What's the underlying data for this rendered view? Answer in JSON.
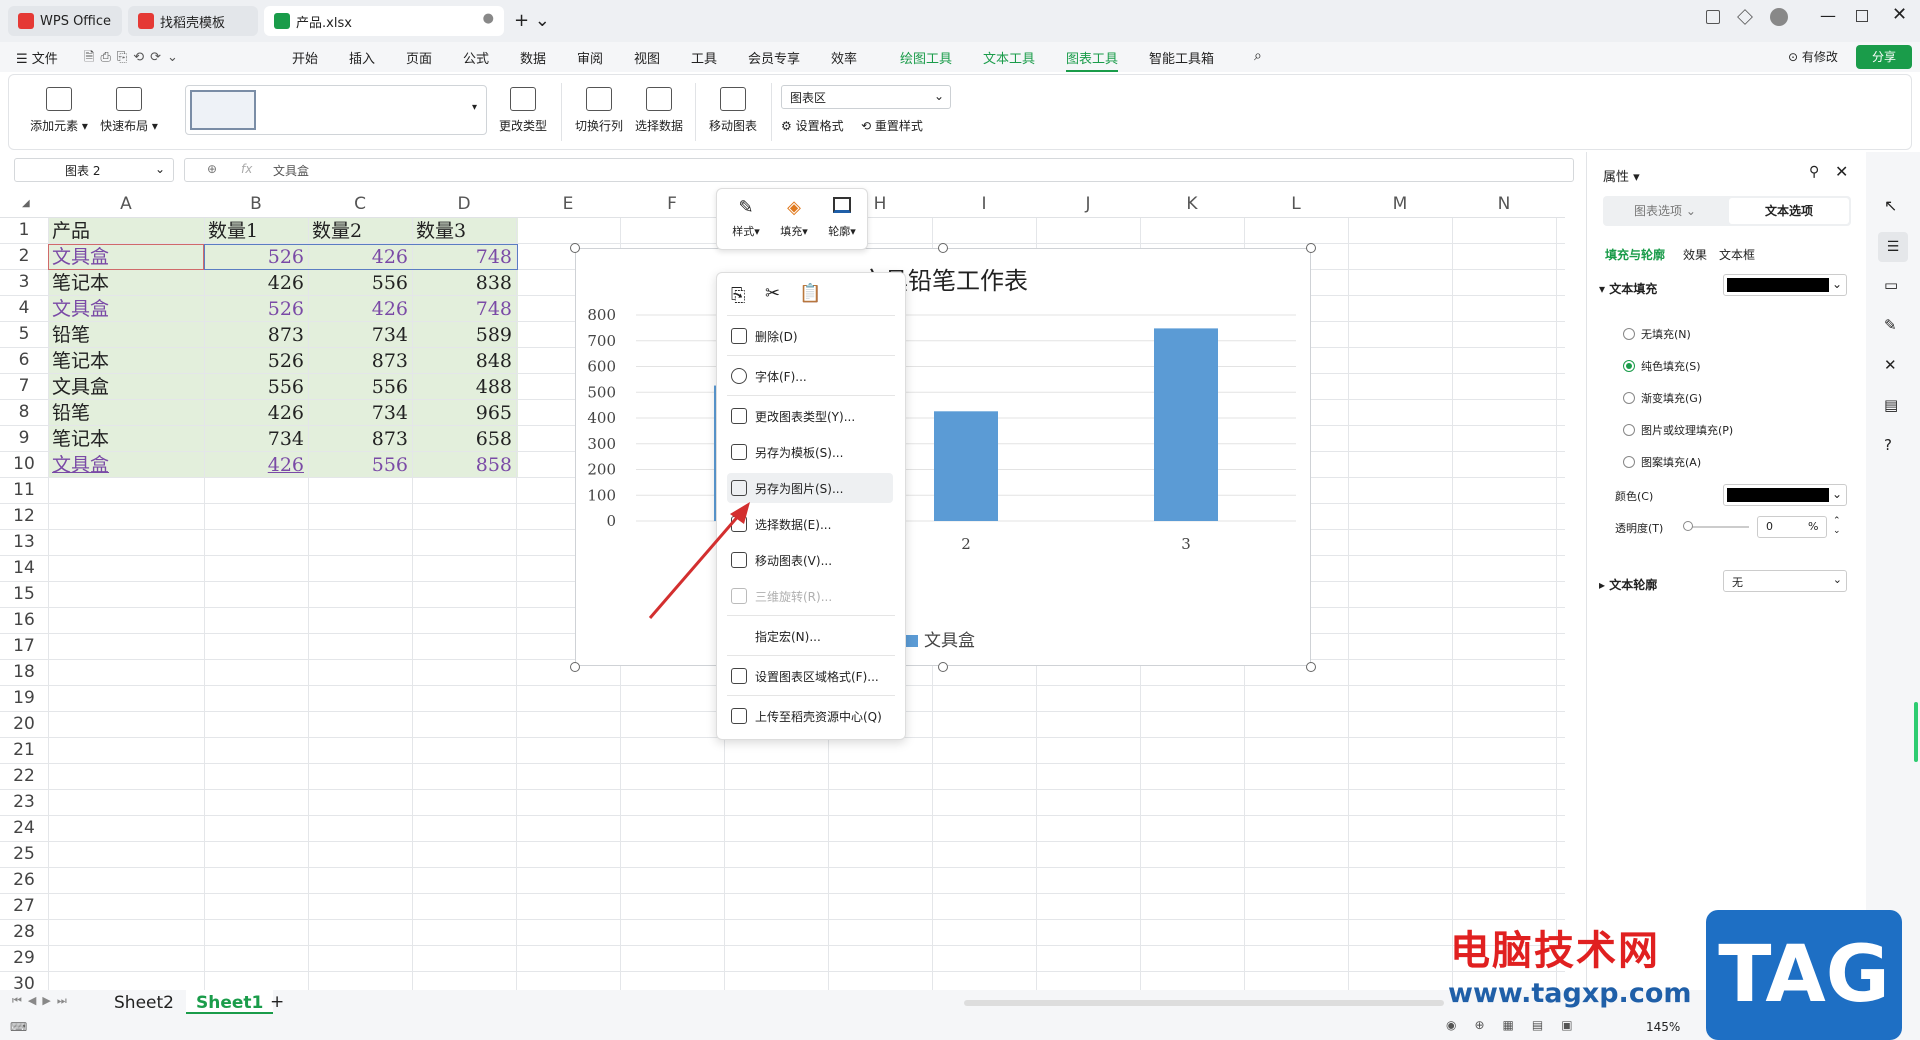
{
  "tabs": [
    {
      "label": "WPS Office"
    },
    {
      "label": "找稻壳模板"
    },
    {
      "label": "产品.xlsx"
    }
  ],
  "titlebar_right": {
    "revision": "有修改",
    "share": "分享"
  },
  "menu": [
    "文件",
    "开始",
    "插入",
    "页面",
    "公式",
    "数据",
    "审阅",
    "视图",
    "工具",
    "会员专享",
    "效率",
    "绘图工具",
    "文本工具",
    "图表工具",
    "智能工具箱"
  ],
  "ribbon": {
    "add_element": "添加元素",
    "quick_layout": "快速布局",
    "change_type": "更改类型",
    "switch_rowcol": "切换行列",
    "select_data": "选择数据",
    "move_chart": "移动图表",
    "chart_area": "图表区",
    "set_format": "设置格式",
    "reset_style": "重置样式"
  },
  "formula": {
    "name_box": "图表 2",
    "fx": "fx",
    "value": "文具盒"
  },
  "columns": [
    "A",
    "B",
    "C",
    "D",
    "E",
    "F",
    "G",
    "H",
    "I",
    "J",
    "K",
    "L",
    "M",
    "N"
  ],
  "sheet": {
    "header": [
      "产品",
      "数量1",
      "数量2",
      "数量3"
    ],
    "rows": [
      [
        "文具盒",
        "526",
        "426",
        "748"
      ],
      [
        "笔记本",
        "426",
        "556",
        "838"
      ],
      [
        "文具盒",
        "526",
        "426",
        "748"
      ],
      [
        "铅笔",
        "873",
        "734",
        "589"
      ],
      [
        "笔记本",
        "526",
        "873",
        "848"
      ],
      [
        "文具盒",
        "556",
        "556",
        "488"
      ],
      [
        "铅笔",
        "426",
        "734",
        "965"
      ],
      [
        "笔记本",
        "734",
        "873",
        "658"
      ],
      [
        "文具盒",
        "426",
        "556",
        "858"
      ]
    ],
    "row_numbers": [
      "1",
      "2",
      "3",
      "4",
      "5",
      "6",
      "7",
      "8",
      "9",
      "10",
      "11",
      "12",
      "13",
      "14",
      "15",
      "16",
      "17",
      "18",
      "19",
      "20",
      "21",
      "22",
      "23",
      "24",
      "25",
      "26",
      "27",
      "28",
      "29",
      "30"
    ]
  },
  "chart_toolbar": {
    "style": "样式",
    "fill": "填充",
    "outline": "轮廓"
  },
  "chart_data": {
    "type": "bar",
    "title": "文具铅笔工作表",
    "categories": [
      "1",
      "2",
      "3"
    ],
    "series": [
      {
        "name": "文具盒",
        "values": [
          526,
          426,
          748
        ]
      }
    ],
    "ylim": [
      0,
      800
    ],
    "yticks": [
      "800",
      "700",
      "600",
      "500",
      "400",
      "300",
      "200",
      "100",
      "0"
    ],
    "legend": "bottom",
    "color": "#5b9bd5"
  },
  "context_menu": {
    "items": [
      "删除(D)",
      "字体(F)...",
      "更改图表类型(Y)...",
      "另存为模板(S)...",
      "另存为图片(S)...",
      "选择数据(E)...",
      "移动图表(V)...",
      "三维旋转(R)...",
      "指定宏(N)...",
      "设置图表区域格式(F)...",
      "上传至稻壳资源中心(Q)"
    ]
  },
  "panel": {
    "title": "属性",
    "tab1": "图表选项",
    "tab2": "文本选项",
    "subtabs": [
      "填充与轮廓",
      "效果",
      "文本框"
    ],
    "text_fill": "文本填充",
    "options": [
      "无填充(N)",
      "纯色填充(S)",
      "渐变填充(G)",
      "图片或纹理填充(P)",
      "图案填充(A)"
    ],
    "color_label": "颜色(C)",
    "transparency_label": "透明度(T)",
    "transparency_value": "0",
    "percent": "%",
    "text_outline": "文本轮廓",
    "outline_value": "无"
  },
  "sheets": [
    "Sheet2",
    "Sheet1"
  ],
  "status": {
    "zoom": "145%"
  },
  "watermark": {
    "title": "电脑技术网",
    "url": "www.tagxp.com",
    "tag": "TAG"
  }
}
